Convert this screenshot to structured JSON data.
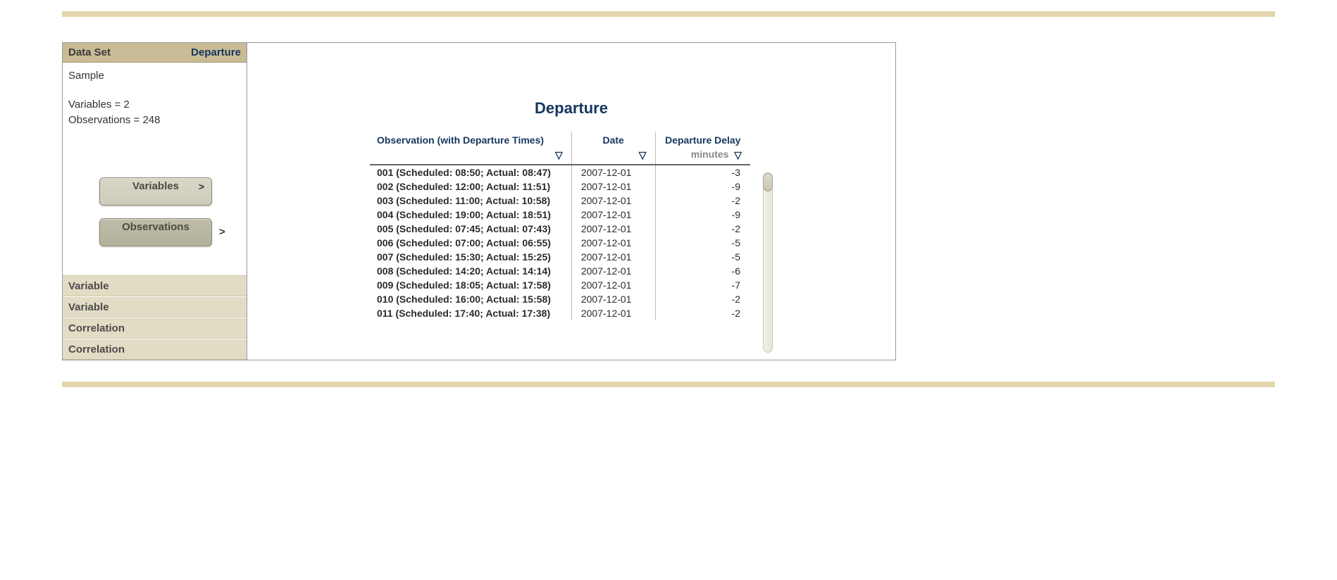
{
  "sidebar": {
    "header_label": "Data Set",
    "header_value": "Departure",
    "sample_label": "Sample",
    "variables_line": "Variables = 2",
    "observations_line": "Observations = 248",
    "buttons": {
      "variables": "Variables",
      "observations": "Observations"
    },
    "footer_items": [
      "Variable",
      "Variable",
      "Correlation",
      "Correlation"
    ]
  },
  "main": {
    "title": "Departure",
    "columns": {
      "observation": "Observation (with Departure Times)",
      "date": "Date",
      "delay": "Departure Delay",
      "delay_units": "minutes"
    },
    "rows": [
      {
        "obs": "001 (Scheduled: 08:50; Actual: 08:47)",
        "date": "2007-12-01",
        "delay": "-3"
      },
      {
        "obs": "002 (Scheduled: 12:00; Actual: 11:51)",
        "date": "2007-12-01",
        "delay": "-9"
      },
      {
        "obs": "003 (Scheduled: 11:00; Actual: 10:58)",
        "date": "2007-12-01",
        "delay": "-2"
      },
      {
        "obs": "004 (Scheduled: 19:00; Actual: 18:51)",
        "date": "2007-12-01",
        "delay": "-9"
      },
      {
        "obs": "005 (Scheduled: 07:45; Actual: 07:43)",
        "date": "2007-12-01",
        "delay": "-2"
      },
      {
        "obs": "006 (Scheduled: 07:00; Actual: 06:55)",
        "date": "2007-12-01",
        "delay": "-5"
      },
      {
        "obs": "007 (Scheduled: 15:30; Actual: 15:25)",
        "date": "2007-12-01",
        "delay": "-5"
      },
      {
        "obs": "008 (Scheduled: 14:20; Actual: 14:14)",
        "date": "2007-12-01",
        "delay": "-6"
      },
      {
        "obs": "009 (Scheduled: 18:05; Actual: 17:58)",
        "date": "2007-12-01",
        "delay": "-7"
      },
      {
        "obs": "010 (Scheduled: 16:00; Actual: 15:58)",
        "date": "2007-12-01",
        "delay": "-2"
      },
      {
        "obs": "011 (Scheduled: 17:40; Actual: 17:38)",
        "date": "2007-12-01",
        "delay": "-2"
      }
    ]
  }
}
